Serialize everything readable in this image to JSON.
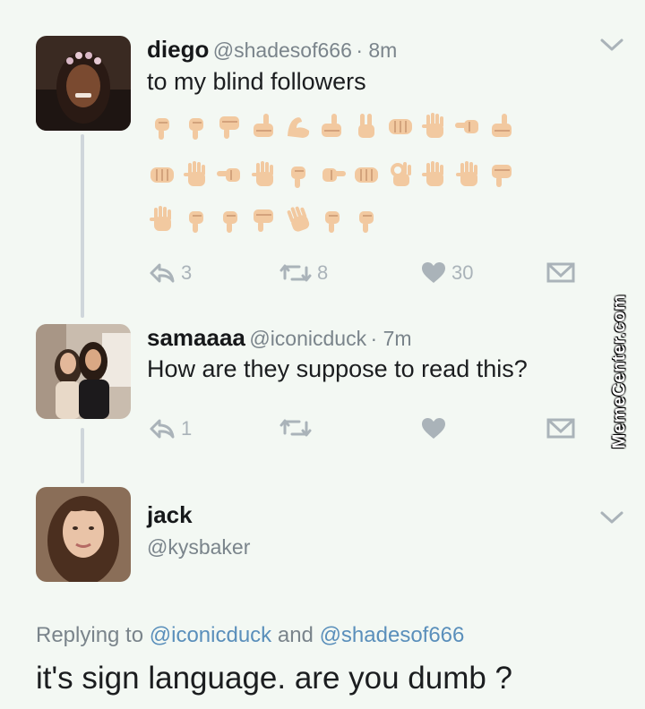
{
  "tweet1": {
    "name": "diego",
    "handle": "@shadesof666",
    "time": "· 8m",
    "text": "to my blind followers",
    "emoji_rows": [
      [
        "pointing-down",
        "pointing-down",
        "thumbs-down",
        "thumbs-up",
        "flexed-biceps",
        "thumbs-up",
        "victory-hand",
        "oncoming-fist",
        "raised-hand",
        "pointing-left",
        "thumbs-up"
      ],
      [
        "oncoming-fist",
        "raised-hand",
        "pointing-left",
        "raised-hand",
        "pointing-down",
        "pointing-right",
        "oncoming-fist",
        "ok-hand",
        "raised-hand",
        "raised-hand",
        "thumbs-down"
      ],
      [
        "raised-hand",
        "pointing-down",
        "pointing-down",
        "thumbs-down",
        "waving-hand",
        "pointing-down",
        "pointing-down"
      ]
    ],
    "replies": "3",
    "retweets": "8",
    "likes": "30"
  },
  "tweet2": {
    "name": "samaaaa",
    "handle": "@iconicduck",
    "time": "· 7m",
    "text": "How are they suppose to read this?",
    "replies": "1"
  },
  "tweet3": {
    "name": "jack",
    "handle": "@kysbaker",
    "replying_prefix": "Replying to",
    "mention1": "@iconicduck",
    "and_word": "and",
    "mention2": "@shadesof666",
    "text": "it's sign language. are you dumb ?"
  },
  "watermark": "MemeCenter.com",
  "colors": {
    "background": "#f3f8f3",
    "icon_gray": "#aab3b9",
    "mention_blue": "#5a8fbb",
    "skin": "#f2c9a0"
  }
}
